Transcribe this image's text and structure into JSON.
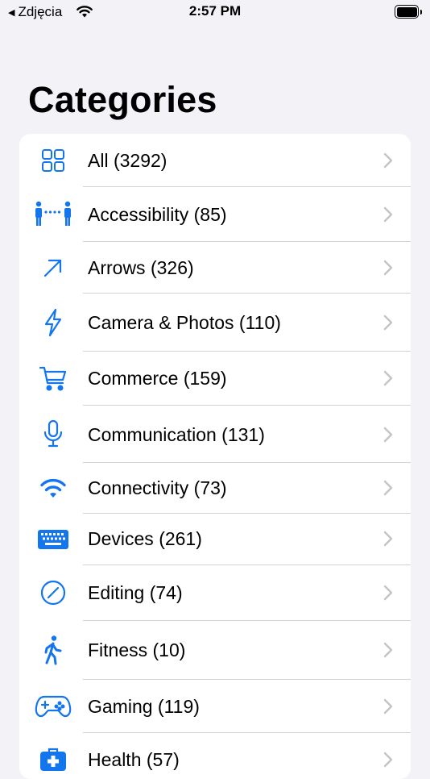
{
  "status_bar": {
    "back_app": "Zdjęcia",
    "time": "2:57 PM"
  },
  "header": {
    "title": "Categories"
  },
  "categories": [
    {
      "label": "All (3292)",
      "icon": "grid-icon"
    },
    {
      "label": "Accessibility (85)",
      "icon": "people-distance-icon"
    },
    {
      "label": "Arrows (326)",
      "icon": "arrow-up-right-icon"
    },
    {
      "label": "Camera & Photos (110)",
      "icon": "bolt-icon"
    },
    {
      "label": "Commerce (159)",
      "icon": "cart-icon"
    },
    {
      "label": "Communication (131)",
      "icon": "mic-icon"
    },
    {
      "label": "Connectivity (73)",
      "icon": "wifi-icon"
    },
    {
      "label": "Devices (261)",
      "icon": "keyboard-icon"
    },
    {
      "label": "Editing (74)",
      "icon": "slash-circle-icon"
    },
    {
      "label": "Fitness (10)",
      "icon": "walking-figure-icon"
    },
    {
      "label": "Gaming (119)",
      "icon": "gamecontroller-icon"
    },
    {
      "label": "Health (57)",
      "icon": "medical-bag-icon"
    }
  ],
  "colors": {
    "accent": "#1476ee",
    "background": "#f2f2f7",
    "separator": "#d1d1d6",
    "chevron": "#c4c4c7"
  }
}
